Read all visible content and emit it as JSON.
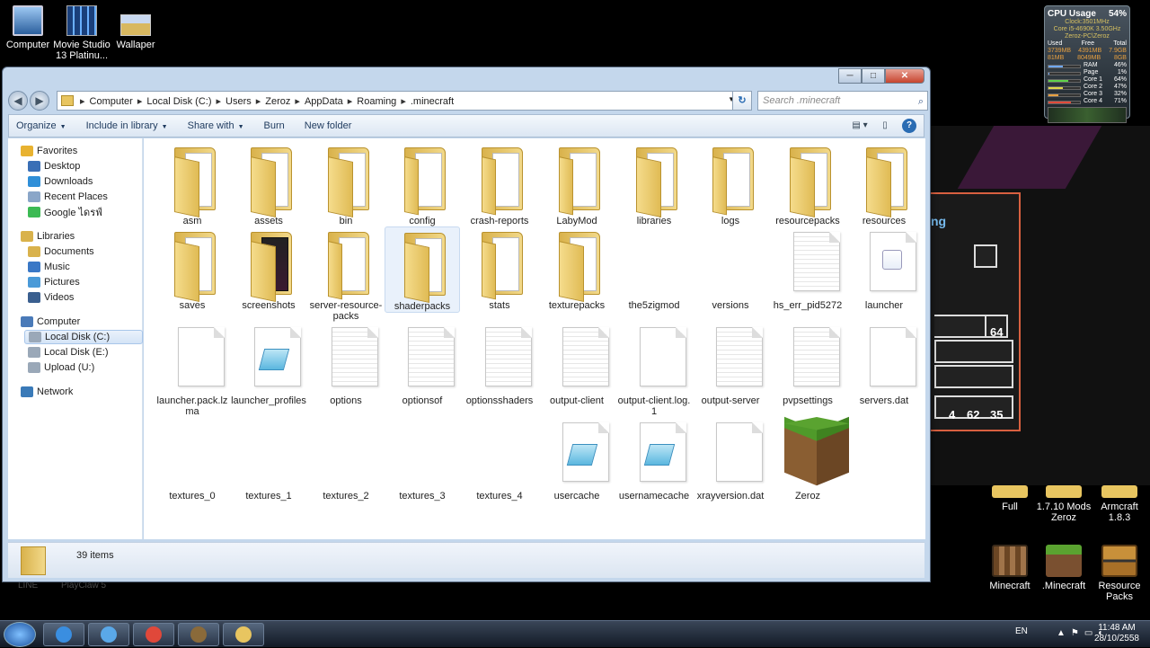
{
  "desktop": {
    "icons": [
      {
        "label": "Computer",
        "icon": "computer-icon"
      },
      {
        "label": "Movie Studio 13 Platinu...",
        "icon": "movie-studio-icon"
      },
      {
        "label": "Wallaper",
        "icon": "wallpaper-icon"
      }
    ],
    "right_icons": [
      {
        "label": "Full"
      },
      {
        "label": "1.7.10 Mods Zeroz"
      },
      {
        "label": "Armcraft 1.8.3"
      },
      {
        "label": "Minecraft"
      },
      {
        "label": ".Minecraft"
      },
      {
        "label": "Resource Packs"
      }
    ],
    "behind_labels": [
      "LINE",
      "PlayClaw 5"
    ]
  },
  "game": {
    "partial_text": "ng",
    "counts": [
      "64",
      "4",
      "62",
      "35"
    ]
  },
  "gadget": {
    "title": "CPU Usage",
    "percent": "54%",
    "clock": "Clock:3501MHz",
    "cpu": "Core i5-4690K 3.50GHz",
    "host": "Zeroz-PC\\Zeroz",
    "headers": [
      "Used",
      "Free",
      "Total"
    ],
    "rows": [
      [
        "3739MB",
        "4391MB",
        "7.9GB"
      ],
      [
        "81MB",
        "8049MB",
        "8GB"
      ]
    ],
    "meters": [
      {
        "label": "RAM",
        "value": "46%",
        "color": "#6fa8ff",
        "level": 0.46
      },
      {
        "label": "Page",
        "value": "1%",
        "color": "#6fa8ff",
        "level": 0.01
      },
      {
        "label": "Core 1",
        "value": "64%",
        "color": "#5ed24a",
        "level": 0.64
      },
      {
        "label": "Core 2",
        "value": "47%",
        "color": "#e0d84a",
        "level": 0.47
      },
      {
        "label": "Core 3",
        "value": "32%",
        "color": "#e8a040",
        "level": 0.32
      },
      {
        "label": "Core 4",
        "value": "71%",
        "color": "#e04a3a",
        "level": 0.71
      }
    ]
  },
  "window": {
    "caption_buttons": [
      "─",
      "□",
      "✕"
    ],
    "breadcrumb": [
      "Computer",
      "Local Disk (C:)",
      "Users",
      "Zeroz",
      "AppData",
      "Roaming",
      ".minecraft"
    ],
    "search_placeholder": "Search .minecraft",
    "toolbar": [
      {
        "label": "Organize",
        "dropdown": true
      },
      {
        "label": "Include in library",
        "dropdown": true
      },
      {
        "label": "Share with",
        "dropdown": true
      },
      {
        "label": "Burn",
        "dropdown": false
      },
      {
        "label": "New folder",
        "dropdown": false
      }
    ],
    "nav": [
      {
        "label": "Favorites",
        "type": "group",
        "icon": "star-icon",
        "color": "#e8b230"
      },
      {
        "label": "Desktop",
        "type": "item",
        "icon": "desktop-icon",
        "color": "#3a6fb6"
      },
      {
        "label": "Downloads",
        "type": "item",
        "icon": "downloads-icon",
        "color": "#2f8fd8"
      },
      {
        "label": "Recent Places",
        "type": "item",
        "icon": "recent-places-icon",
        "color": "#8aa6c8"
      },
      {
        "label": "Google ไดรฟ์",
        "type": "item",
        "icon": "google-drive-icon",
        "color": "#3cba54"
      },
      {
        "label": "Libraries",
        "type": "group",
        "icon": "libraries-icon",
        "color": "#d9b24c"
      },
      {
        "label": "Documents",
        "type": "item",
        "icon": "documents-icon",
        "color": "#d9b24c"
      },
      {
        "label": "Music",
        "type": "item",
        "icon": "music-icon",
        "color": "#3a78c6"
      },
      {
        "label": "Pictures",
        "type": "item",
        "icon": "pictures-icon",
        "color": "#4a9ad8"
      },
      {
        "label": "Videos",
        "type": "item",
        "icon": "videos-icon",
        "color": "#3a5f8f"
      },
      {
        "label": "Computer",
        "type": "group",
        "icon": "computer-icon",
        "color": "#4a7ab8"
      },
      {
        "label": "Local Disk (C:)",
        "type": "item",
        "icon": "drive-icon",
        "color": "#9aa8b8",
        "selected": true
      },
      {
        "label": "Local Disk (E:)",
        "type": "item",
        "icon": "drive-icon",
        "color": "#9aa8b8"
      },
      {
        "label": "Upload (U:)",
        "type": "item",
        "icon": "drive-icon",
        "color": "#9aa8b8"
      },
      {
        "label": "Network",
        "type": "group",
        "icon": "network-icon",
        "color": "#3a7ab8"
      }
    ],
    "items": [
      {
        "name": "asm",
        "kind": "folder"
      },
      {
        "name": "assets",
        "kind": "folder"
      },
      {
        "name": "bin",
        "kind": "folder"
      },
      {
        "name": "config",
        "kind": "folder-open"
      },
      {
        "name": "crash-reports",
        "kind": "folder-open"
      },
      {
        "name": "LabyMod",
        "kind": "folder-open"
      },
      {
        "name": "libraries",
        "kind": "folder"
      },
      {
        "name": "logs",
        "kind": "folder-open"
      },
      {
        "name": "resourcepacks",
        "kind": "folder"
      },
      {
        "name": "resources",
        "kind": "folder"
      },
      {
        "name": "saves",
        "kind": "folder"
      },
      {
        "name": "screenshots",
        "kind": "folder-shot"
      },
      {
        "name": "server-resource-packs",
        "kind": "folder-open"
      },
      {
        "name": "shaderpacks",
        "kind": "folder",
        "hover": true
      },
      {
        "name": "stats",
        "kind": "folder-open"
      },
      {
        "name": "texturepacks",
        "kind": "folder"
      },
      {
        "name": "the5zigmod",
        "kind": "blank"
      },
      {
        "name": "versions",
        "kind": "blank"
      },
      {
        "name": "hs_err_pid5272",
        "kind": "doc-lines"
      },
      {
        "name": "launcher",
        "kind": "doc-java"
      },
      {
        "name": "launcher.pack.lzma",
        "kind": "doc"
      },
      {
        "name": "launcher_profiles",
        "kind": "doc-notepad"
      },
      {
        "name": "options",
        "kind": "doc-lines"
      },
      {
        "name": "optionsof",
        "kind": "doc-lines"
      },
      {
        "name": "optionsshaders",
        "kind": "doc-lines"
      },
      {
        "name": "output-client",
        "kind": "doc-lines"
      },
      {
        "name": "output-client.log.1",
        "kind": "doc"
      },
      {
        "name": "output-server",
        "kind": "doc-lines"
      },
      {
        "name": "pvpsettings",
        "kind": "doc-lines"
      },
      {
        "name": "servers.dat",
        "kind": "doc"
      },
      {
        "name": "textures_0",
        "kind": "blank"
      },
      {
        "name": "textures_1",
        "kind": "blank"
      },
      {
        "name": "textures_2",
        "kind": "blank"
      },
      {
        "name": "textures_3",
        "kind": "blank"
      },
      {
        "name": "textures_4",
        "kind": "blank"
      },
      {
        "name": "usercache",
        "kind": "doc-notepad"
      },
      {
        "name": "usernamecache",
        "kind": "doc-notepad"
      },
      {
        "name": "xrayversion.dat",
        "kind": "doc"
      },
      {
        "name": "Zeroz",
        "kind": "grass"
      }
    ],
    "status": "39 items"
  },
  "taskbar": {
    "apps": [
      {
        "icon": "media-icon",
        "color": "#3a8ee0"
      },
      {
        "icon": "live-mail-icon",
        "color": "#5aa8e8"
      },
      {
        "icon": "chrome-icon",
        "color": "#e0483a"
      },
      {
        "icon": "minecraft-launcher-icon",
        "color": "#8a6a3a"
      },
      {
        "icon": "explorer-icon",
        "color": "#e8c560"
      }
    ],
    "lang": "EN",
    "time": "11:48 AM",
    "date": "28/10/2558"
  }
}
